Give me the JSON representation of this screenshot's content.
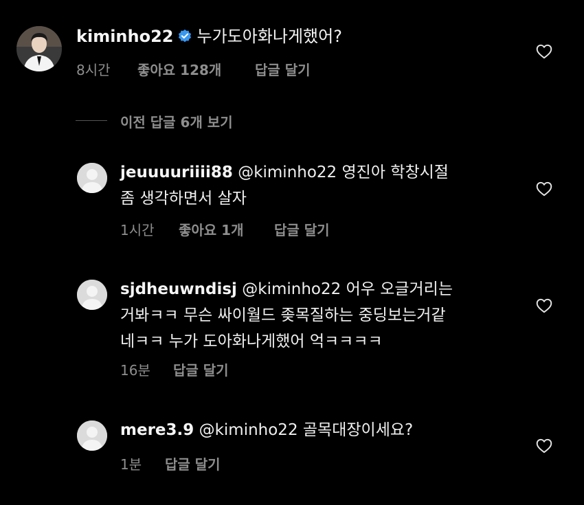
{
  "top_comment": {
    "username": "kiminho22",
    "text": "누가도아화나게했어?",
    "time": "8시간",
    "likes": "좋아요 128개",
    "reply": "답글 달기"
  },
  "view_replies": "이전 답글 6개 보기",
  "replies": [
    {
      "username": "jeuuuuriiii88",
      "mention": "@kiminho22",
      "line1": "영진아 학창시절",
      "line2": "좀 생각하면서 살자",
      "time": "1시간",
      "likes": "좋아요 1개",
      "reply": "답글 달기"
    },
    {
      "username": "sjdheuwndisj",
      "mention": "@kiminho22",
      "line1": "어우 오글거리는",
      "line2": "거봐ㅋㅋ 무슨 싸이월드 좆목질하는 중딩보는거같",
      "line3": "네ㅋㅋ 누가 도아화나게했어 억ㅋㅋㅋㅋ",
      "time": "16분",
      "reply": "답글 달기"
    },
    {
      "username": "mere3.9",
      "mention": "@kiminho22",
      "line1": "골목대장이세요?",
      "time": "1분",
      "reply": "답글 달기"
    }
  ],
  "icons": {
    "verified": "verified-badge-icon",
    "heart": "heart-outline-icon",
    "default_avatar": "default-avatar-icon"
  },
  "colors": {
    "background": "#000000",
    "text": "#f5f5f5",
    "meta": "#8e8e8e",
    "verified": "#3897f0"
  }
}
